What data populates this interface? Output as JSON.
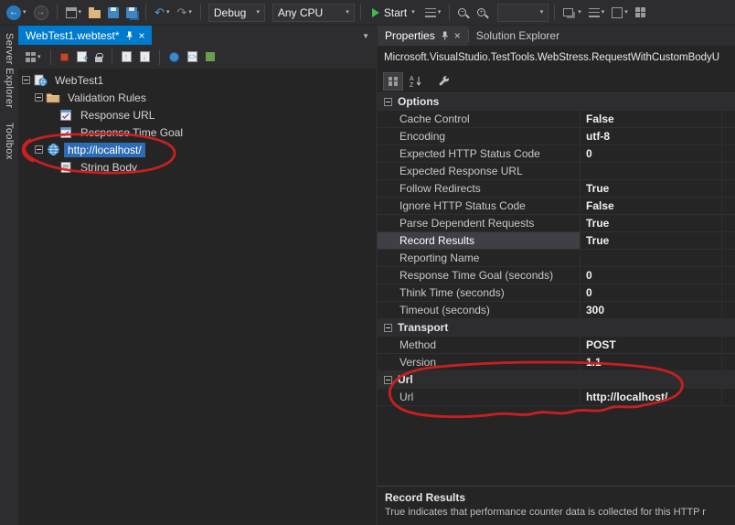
{
  "colors": {
    "accent_blue": "#007acc",
    "selection_blue": "#2d6bb4",
    "annotation_red": "#d21f1f",
    "start_green": "#3fba4e"
  },
  "toolbar": {
    "debug_label": "Debug",
    "platform_label": "Any CPU",
    "start_label": "Start"
  },
  "rail": {
    "tabs": [
      {
        "label": "Server Explorer"
      },
      {
        "label": "Toolbox"
      }
    ]
  },
  "document": {
    "tab_label": "WebTest1.webtest*",
    "tree": [
      {
        "label": "WebTest1",
        "level": 0,
        "icon": "webtest",
        "expandable": true,
        "selected": false
      },
      {
        "label": "Validation Rules",
        "level": 1,
        "icon": "folder",
        "expandable": true,
        "selected": false
      },
      {
        "label": "Response URL",
        "level": 2,
        "icon": "validation-rule",
        "expandable": false,
        "selected": false
      },
      {
        "label": "Response Time Goal",
        "level": 2,
        "icon": "validation-rule",
        "expandable": false,
        "selected": false
      },
      {
        "label": "http://localhost/",
        "level": 1,
        "icon": "request",
        "expandable": true,
        "selected": true
      },
      {
        "label": "String Body",
        "level": 2,
        "icon": "string-body",
        "expandable": false,
        "selected": false
      }
    ]
  },
  "properties": {
    "tab_properties": "Properties",
    "tab_solution_explorer": "Solution Explorer",
    "object_name": "Microsoft.VisualStudio.TestTools.WebStress.RequestWithCustomBodyU",
    "groups": [
      {
        "name": "Options",
        "rows": [
          {
            "name": "Cache Control",
            "value": "False"
          },
          {
            "name": "Encoding",
            "value": "utf-8"
          },
          {
            "name": "Expected HTTP Status Code",
            "value": "0"
          },
          {
            "name": "Expected Response URL",
            "value": ""
          },
          {
            "name": "Follow Redirects",
            "value": "True"
          },
          {
            "name": "Ignore HTTP Status Code",
            "value": "False"
          },
          {
            "name": "Parse Dependent Requests",
            "value": "True"
          },
          {
            "name": "Record Results",
            "value": "True",
            "selected": true
          },
          {
            "name": "Reporting Name",
            "value": ""
          },
          {
            "name": "Response Time Goal (seconds)",
            "value": "0"
          },
          {
            "name": "Think Time (seconds)",
            "value": "0"
          },
          {
            "name": "Timeout (seconds)",
            "value": "300"
          }
        ]
      },
      {
        "name": "Transport",
        "rows": [
          {
            "name": "Method",
            "value": "POST"
          },
          {
            "name": "Version",
            "value": "1.1"
          }
        ]
      },
      {
        "name": "Url",
        "rows": [
          {
            "name": "Url",
            "value": "http://localhost/"
          }
        ]
      }
    ],
    "description_title": "Record Results",
    "description_text": "True indicates that performance counter data is collected for this HTTP r"
  }
}
